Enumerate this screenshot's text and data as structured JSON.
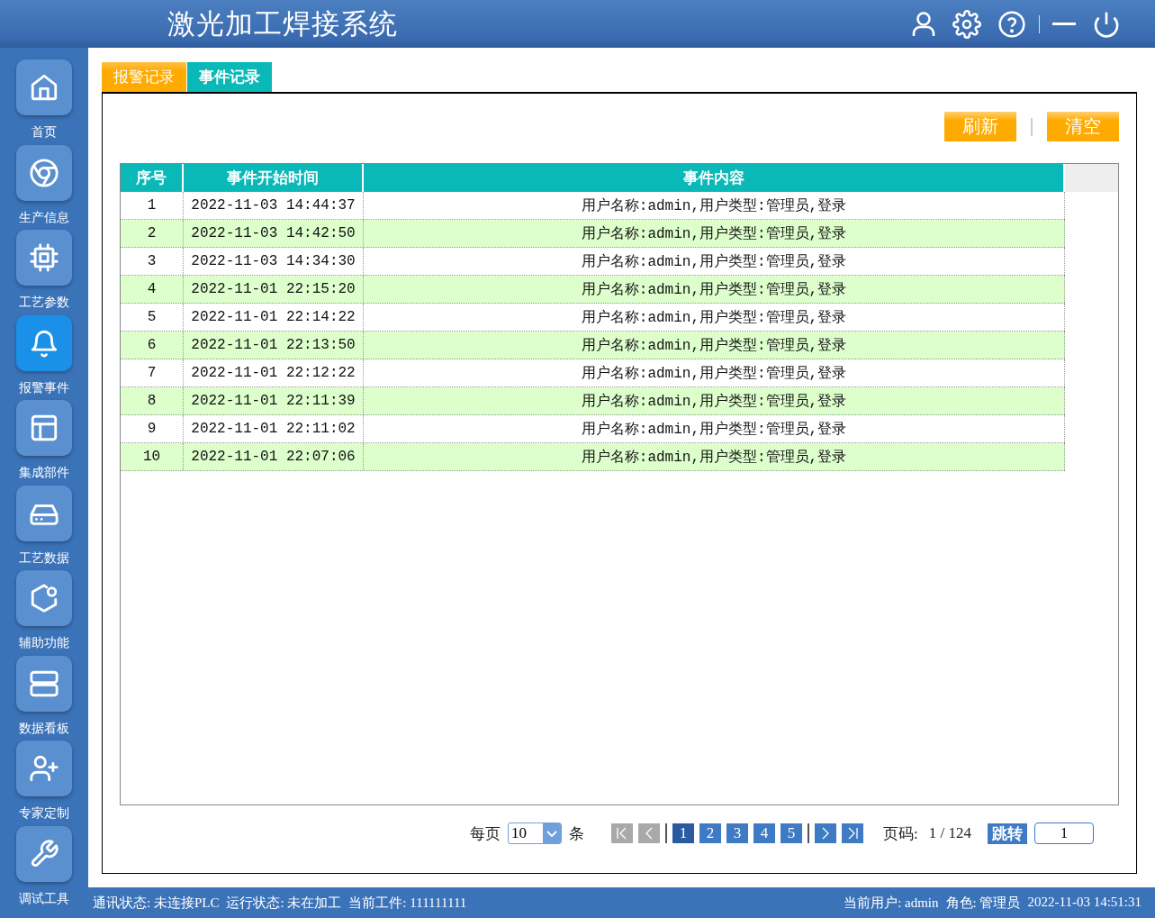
{
  "header": {
    "title": "激光加工焊接系统"
  },
  "sidebar": {
    "items": [
      {
        "label": "首页",
        "selected": false
      },
      {
        "label": "生产信息",
        "selected": false
      },
      {
        "label": "工艺参数",
        "selected": false
      },
      {
        "label": "报警事件",
        "selected": true
      },
      {
        "label": "集成部件",
        "selected": false
      },
      {
        "label": "工艺数据",
        "selected": false
      },
      {
        "label": "辅助功能",
        "selected": false
      },
      {
        "label": "数据看板",
        "selected": false
      },
      {
        "label": "专家定制",
        "selected": false
      },
      {
        "label": "调试工具",
        "selected": false
      }
    ]
  },
  "tabs": [
    {
      "label": "报警记录",
      "selected": false
    },
    {
      "label": "事件记录",
      "selected": true
    }
  ],
  "toolbar": {
    "buttons": [
      "刷新",
      "清空"
    ]
  },
  "table": {
    "columns": [
      "序号",
      "事件开始时间",
      "事件内容"
    ],
    "rows": [
      [
        "1",
        "2022-11-03 14:44:37",
        "用户名称:admin,用户类型:管理员,登录"
      ],
      [
        "2",
        "2022-11-03 14:42:50",
        "用户名称:admin,用户类型:管理员,登录"
      ],
      [
        "3",
        "2022-11-03 14:34:30",
        "用户名称:admin,用户类型:管理员,登录"
      ],
      [
        "4",
        "2022-11-01 22:15:20",
        "用户名称:admin,用户类型:管理员,登录"
      ],
      [
        "5",
        "2022-11-01 22:14:22",
        "用户名称:admin,用户类型:管理员,登录"
      ],
      [
        "6",
        "2022-11-01 22:13:50",
        "用户名称:admin,用户类型:管理员,登录"
      ],
      [
        "7",
        "2022-11-01 22:12:22",
        "用户名称:admin,用户类型:管理员,登录"
      ],
      [
        "8",
        "2022-11-01 22:11:39",
        "用户名称:admin,用户类型:管理员,登录"
      ],
      [
        "9",
        "2022-11-01 22:11:02",
        "用户名称:admin,用户类型:管理员,登录"
      ],
      [
        "10",
        "2022-11-01 22:07:06",
        "用户名称:admin,用户类型:管理员,登录"
      ]
    ]
  },
  "pagination": {
    "per_page_label": "每页",
    "per_page": "10",
    "unit": "条",
    "nav_before": [
      {
        "kind": "first",
        "disabled": true
      },
      {
        "kind": "prev",
        "disabled": true
      }
    ],
    "pages": [
      {
        "label": "1",
        "selected": true
      },
      {
        "label": "2",
        "selected": false
      },
      {
        "label": "3",
        "selected": false
      },
      {
        "label": "4",
        "selected": false
      },
      {
        "label": "5",
        "selected": false
      }
    ],
    "nav_after": [
      {
        "kind": "next",
        "disabled": false
      },
      {
        "kind": "last",
        "disabled": false
      }
    ],
    "page_label": "页码:",
    "page_info": "1 / 124",
    "jump_button": "跳转",
    "jump_value": "1"
  },
  "status_bar": {
    "left": [
      "通讯状态: 未连接PLC",
      "运行状态: 未在加工",
      "当前工件: 111111111"
    ],
    "right": [
      "当前用户: admin",
      "角色: 管理员",
      "2022-11-03 14:51:31"
    ]
  }
}
